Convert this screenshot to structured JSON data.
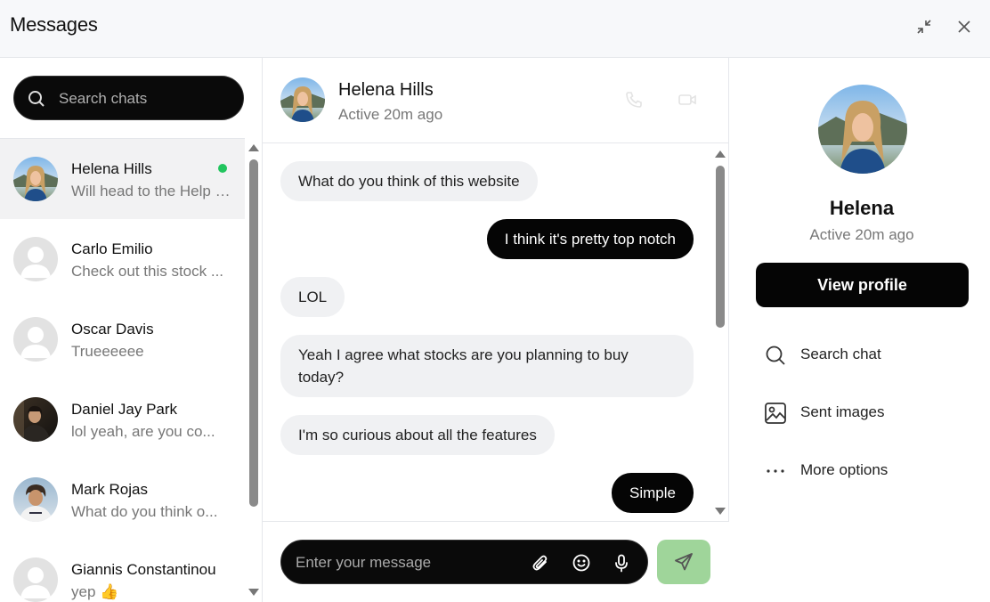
{
  "app": {
    "title": "Messages"
  },
  "header": {
    "minimize_icon": "minimize-arrows-icon",
    "close_icon": "close-icon"
  },
  "sidebar": {
    "search_placeholder": "Search chats",
    "chats": [
      {
        "name": "Helena Hills",
        "preview": "Will head to the Help Center...",
        "online": true,
        "active": true
      },
      {
        "name": "Carlo Emilio",
        "preview": "Check out this stock ...",
        "online": false
      },
      {
        "name": "Oscar Davis",
        "preview": "Trueeeeee",
        "online": false
      },
      {
        "name": "Daniel Jay Park",
        "preview": "lol yeah, are you co...",
        "online": false
      },
      {
        "name": "Mark Rojas",
        "preview": "What do you think o...",
        "online": false
      },
      {
        "name": "Giannis Constantinou",
        "preview": "yep 👍",
        "online": false
      }
    ]
  },
  "conversation": {
    "name": "Helena Hills",
    "status": "Active 20m ago",
    "messages": [
      {
        "from": "them",
        "text": "What do you think of this website"
      },
      {
        "from": "me",
        "text": "I think it's pretty top notch"
      },
      {
        "from": "them",
        "text": "LOL"
      },
      {
        "from": "them",
        "text": "Yeah I agree what stocks are you planning to buy today?"
      },
      {
        "from": "them",
        "text": "I'm so curious about all the features"
      },
      {
        "from": "me",
        "text": "Simple"
      }
    ],
    "composer_placeholder": "Enter your message"
  },
  "profile": {
    "name": "Helena",
    "status": "Active 20m ago",
    "view_profile_label": "View profile",
    "options": [
      {
        "label": "Search chat",
        "icon": "search-icon"
      },
      {
        "label": "Sent images",
        "icon": "image-icon"
      },
      {
        "label": "More options",
        "icon": "more-dots-icon"
      }
    ]
  },
  "colors": {
    "online": "#22c55e",
    "send_button": "#9fd59a",
    "dark": "#050505"
  }
}
